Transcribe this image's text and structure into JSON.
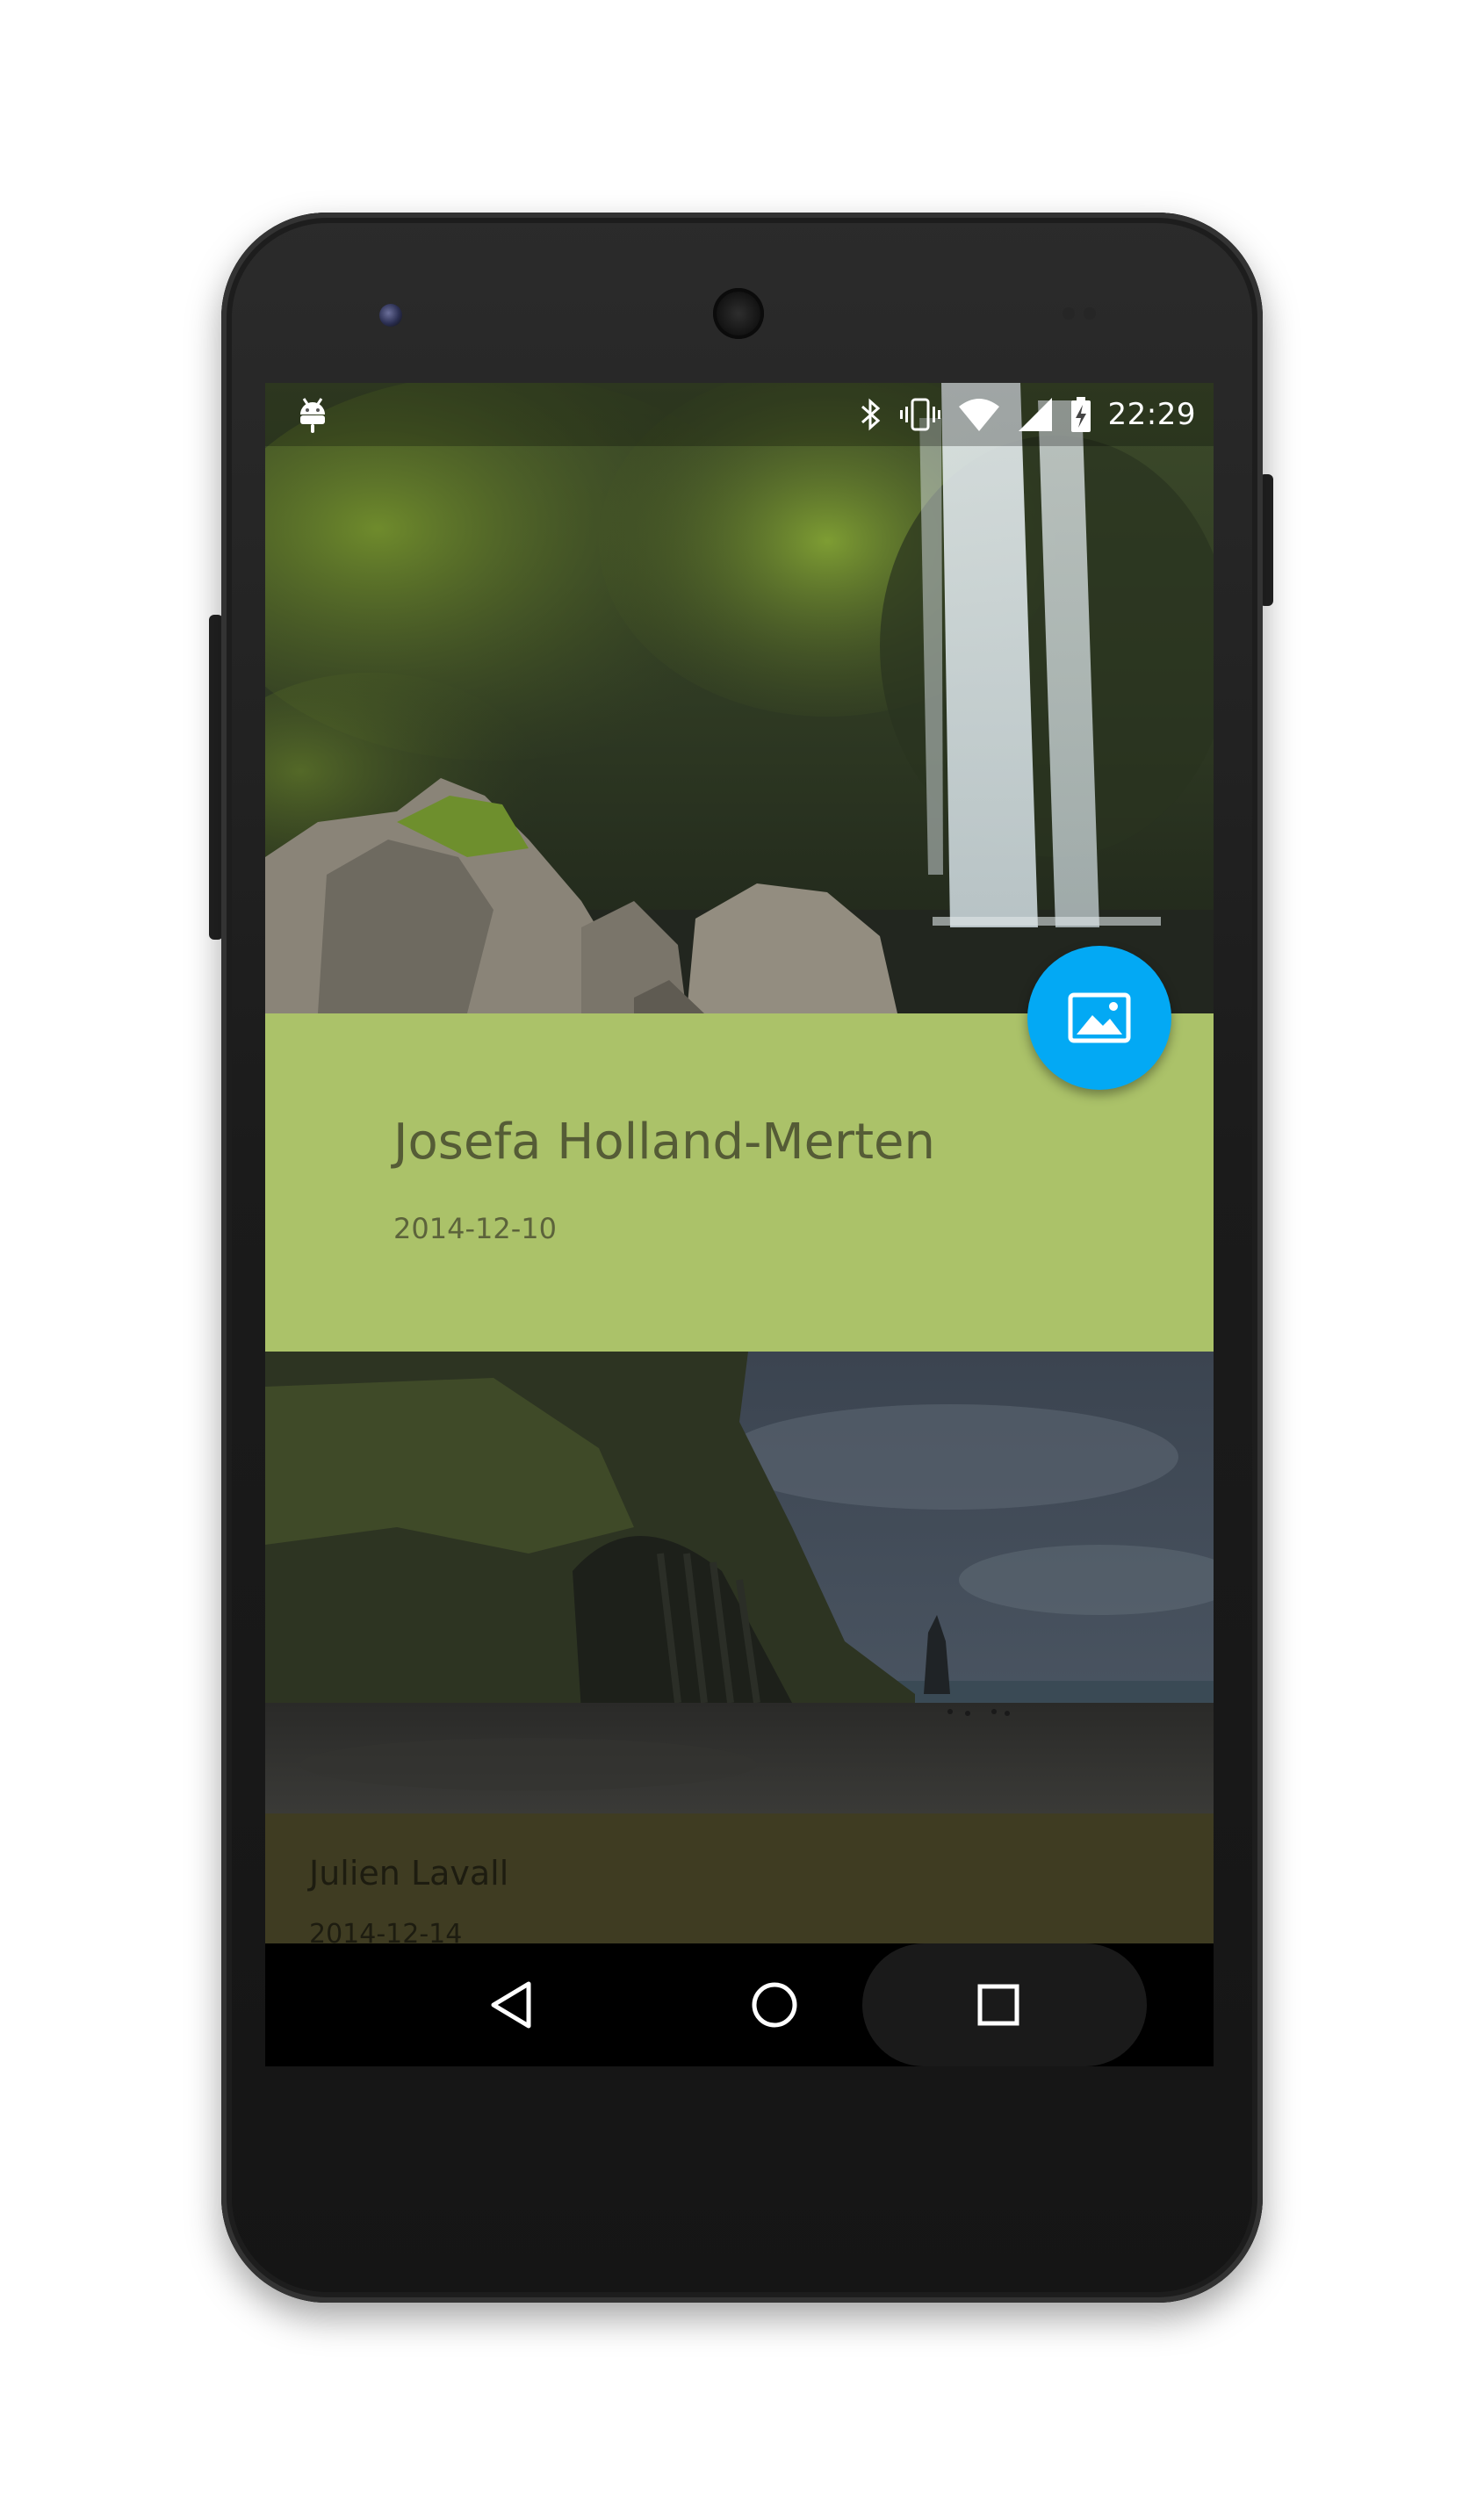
{
  "status_bar": {
    "time": "22:29",
    "icons": [
      "android-debug-icon",
      "bluetooth-icon",
      "vibrate-icon",
      "wifi-icon",
      "cell-signal-icon",
      "battery-charging-icon"
    ]
  },
  "featured_card": {
    "title": "Josefa Holland-Merten",
    "date": "2014-12-10",
    "accent_color": "#abc269",
    "title_color": "#555c36"
  },
  "fab": {
    "icon": "image-icon",
    "color": "#03a9f4"
  },
  "next_card": {
    "title": "Julien Lavall",
    "date": "2014-12-14",
    "color": "#3f3c22"
  },
  "navigation_bar": {
    "buttons": [
      "back-icon",
      "home-icon",
      "recents-icon"
    ]
  }
}
